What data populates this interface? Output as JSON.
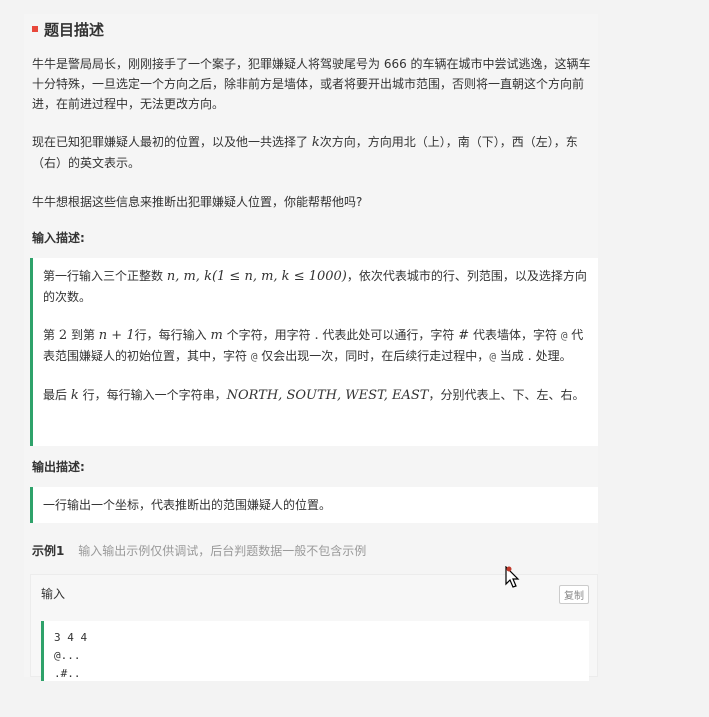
{
  "section": {
    "title": "题目描述"
  },
  "description": {
    "para1": "牛牛是警局局长，刚刚接手了一个案子，犯罪嫌疑人将驾驶尾号为 666 的车辆在城市中尝试逃逸，这辆车十分特殊，一旦选定一个方向之后，除非前方是墙体，或者将要开出城市范围，否则将一直朝这个方向前进，在前进过程中，无法更改方向。",
    "para2_a": "现在已知犯罪嫌疑人最初的位置，以及他一共选择了",
    "para2_k": "k",
    "para2_b": "次方向，方向用北（上），南（下），西（左），东（右）的英文表示。",
    "para3": "牛牛想根据这些信息来推断出犯罪嫌疑人位置，你能帮帮他吗?"
  },
  "input": {
    "heading": "输入描述:",
    "line1_a": "第一行输入三个正整数",
    "line1_math": "n, m, k(1 ≤ n, m, k ≤ 1000)",
    "line1_b": "，依次代表城市的行、列范围，以及选择方向的次数。",
    "line2_a": "第",
    "line2_two": "2",
    "line2_b": "到第",
    "line2_n1": "n + 1",
    "line2_c": "行，每行输入",
    "line2_m": "m",
    "line2_d": "个字符，用字符",
    "line2_dot": ".",
    "line2_e": "代表此处可以通行，字符",
    "line2_hash": "#",
    "line2_f": "代表墙体，字符",
    "line2_at": "@",
    "line2_g": "代表范围嫌疑人的初始位置，其中，字符",
    "line2_at2": "@",
    "line2_h": "仅会出现一次，同时，在后续行走过程中，",
    "line2_at3": "@",
    "line2_i": "当成",
    "line2_dot2": ".",
    "line2_j": "处理。",
    "line3_a": "最后",
    "line3_k": "k",
    "line3_b": "行，每行输入一个字符串，",
    "line3_dirs": "NORTH, SOUTH, WEST, EAST",
    "line3_c": "，分别代表上、下、左、右。"
  },
  "output": {
    "heading": "输出描述:",
    "text": "一行输出一个坐标，代表推断出的范围嫌疑人的位置。"
  },
  "example": {
    "label": "示例1",
    "hint": "输入输出示例仅供调试，后台判题数据一般不包含示例",
    "input_label": "输入",
    "copy_label": "复制",
    "code": "3 4 4\n@...\n.#.."
  },
  "colors": {
    "accent_green": "#2fa26a",
    "title_marker": "#e8483b"
  }
}
